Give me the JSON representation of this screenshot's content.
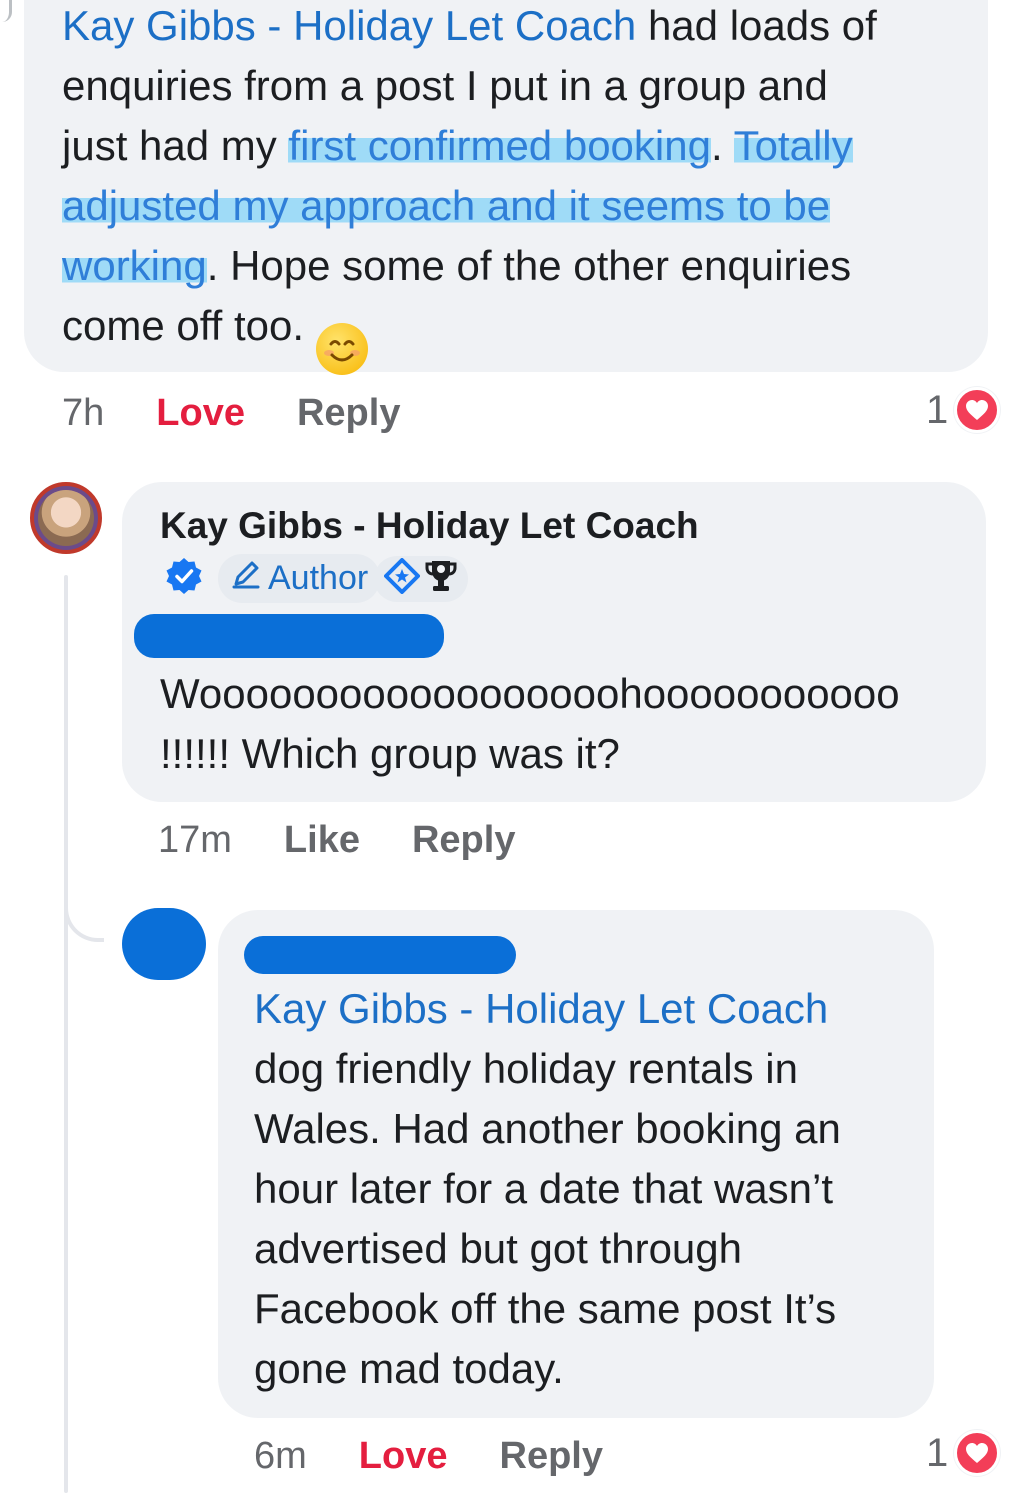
{
  "comment1": {
    "lines": [
      [
        {
          "t": "Kay Gibbs - Holiday Let Coach",
          "s": "mention"
        },
        {
          "t": " had loads of",
          "s": ""
        }
      ],
      [
        {
          "t": "enquiries from a post I put in a group and",
          "s": ""
        }
      ],
      [
        {
          "t": "just had my ",
          "s": ""
        },
        {
          "t": "first confirmed booking",
          "s": "hl"
        },
        {
          "t": ". ",
          "s": ""
        },
        {
          "t": "Totally",
          "s": "hl"
        }
      ],
      [
        {
          "t": "adjusted  my approach and it seems to be",
          "s": "hl"
        }
      ],
      [
        {
          "t": "working",
          "s": "hl"
        },
        {
          "t": ". Hope some of the other enquiries",
          "s": ""
        }
      ],
      [
        {
          "t": "come off too. ",
          "s": ""
        }
      ]
    ],
    "emoji": "😊",
    "time": "7h",
    "love_label": "Love",
    "reply_label": "Reply",
    "reaction_count": "1"
  },
  "comment2": {
    "author": "Kay Gibbs - Holiday Let Coach",
    "author_badge": "Author",
    "lines": [
      "Woooooooooooooooooohooooooooooo",
      "!!!!!! Which group was it?"
    ],
    "time": "17m",
    "like_label": "Like",
    "reply_label": "Reply"
  },
  "comment3": {
    "mention": "Kay Gibbs - Holiday Let Coach",
    "lines": [
      "dog friendly holiday rentals in",
      "Wales. Had another booking an",
      "hour later for a date that wasn’t",
      "advertised but got through",
      "Facebook off the same post It’s",
      "gone mad today."
    ],
    "time": "6m",
    "love_label": "Love",
    "reply_label": "Reply",
    "reaction_count": "1"
  },
  "colors": {
    "bubble": "#f0f2f5",
    "mention": "#1c6fc6",
    "highlight": "#9fdbf7",
    "love": "#e41e3f",
    "redaction": "#0a6fd8",
    "muted": "#65676b"
  },
  "icons": [
    "verified-badge-icon",
    "pencil-icon",
    "rising-star-icon",
    "trophy-icon",
    "heart-icon"
  ]
}
